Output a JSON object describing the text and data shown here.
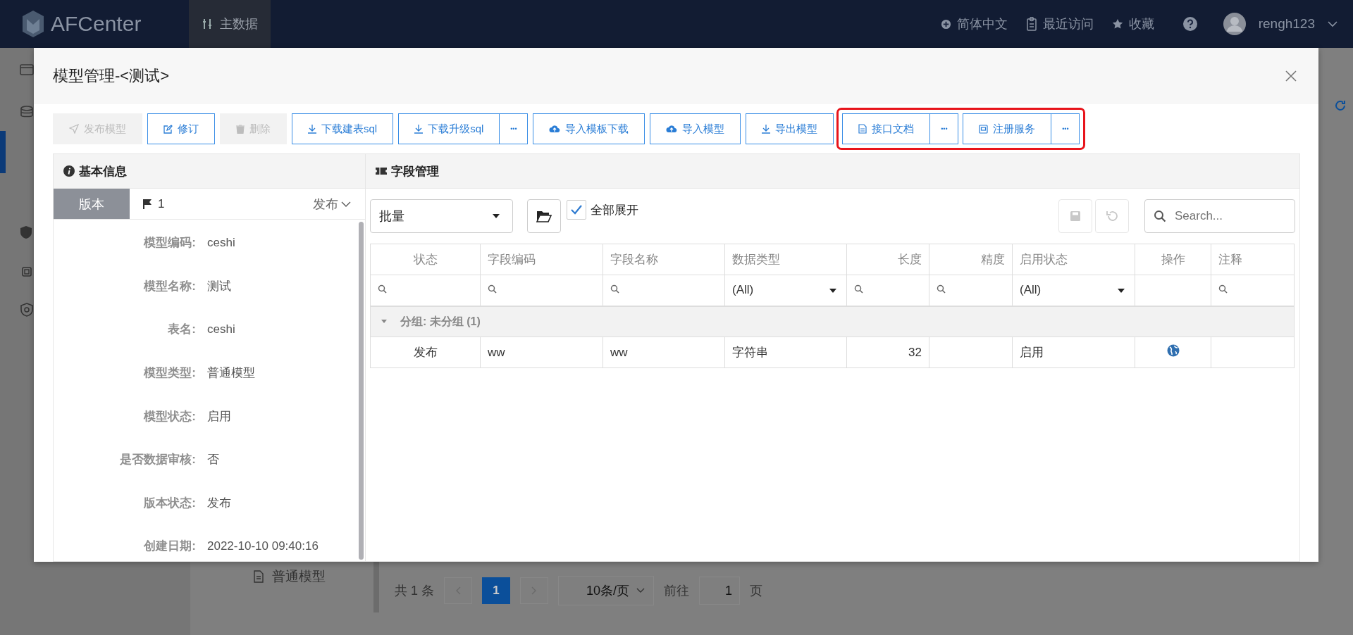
{
  "header": {
    "brand": "AFCenter",
    "nav": [
      {
        "label": "主数据",
        "selected": true
      }
    ],
    "links": [
      {
        "kind": "language",
        "label": "简体中文"
      },
      {
        "kind": "recent",
        "label": "最近访问"
      },
      {
        "kind": "favorites",
        "label": "收藏"
      }
    ],
    "user": "rengh123"
  },
  "background": {
    "tree_item": "普通模型",
    "pagination": {
      "total": "共 1 条",
      "pages": [
        {
          "label": "1",
          "selected": true
        }
      ],
      "page_size": "10条/页",
      "goto_label": "前往",
      "goto_value": "1",
      "goto_suffix": "页"
    }
  },
  "modal": {
    "title": "模型管理-<测试>",
    "toolbar": [
      {
        "highlighted": false,
        "buttons": [
          {
            "label": "发布模型",
            "kind": "send",
            "disabled": true
          },
          {
            "label": "修订",
            "kind": "edit",
            "disabled": false
          },
          {
            "label": "删除",
            "kind": "trash",
            "disabled": true
          },
          {
            "label": "下载建表sql",
            "kind": "download",
            "disabled": false
          },
          {
            "label": "下载升级sql",
            "kind": "download",
            "disabled": false,
            "more": "•••"
          },
          {
            "label": "导入模板下载",
            "kind": "cloud",
            "disabled": false
          },
          {
            "label": "导入模型",
            "kind": "cloud",
            "disabled": false
          },
          {
            "label": "导出模型",
            "kind": "download",
            "disabled": false
          }
        ]
      },
      {
        "highlighted": true,
        "buttons": [
          {
            "label": "接口文档",
            "kind": "doc",
            "disabled": false,
            "more": "•••"
          },
          {
            "label": "注册服务",
            "kind": "service",
            "disabled": false,
            "more": "•••"
          }
        ]
      }
    ],
    "info": {
      "title": "基本信息",
      "version_tab": "版本",
      "version": "1",
      "version_status": "发布",
      "fields": [
        {
          "label": "模型编码:",
          "value": "ceshi"
        },
        {
          "label": "模型名称:",
          "value": "测试"
        },
        {
          "label": "表名:",
          "value": "ceshi"
        },
        {
          "label": "模型类型:",
          "value": "普通模型"
        },
        {
          "label": "模型状态:",
          "value": "启用"
        },
        {
          "label": "是否数据审核:",
          "value": "否"
        },
        {
          "label": "版本状态:",
          "value": "发布"
        },
        {
          "label": "创建日期:",
          "value": "2022-10-10 09:40:16"
        }
      ]
    },
    "fields_panel": {
      "title": "字段管理",
      "batch_select": "批量",
      "expand_all": {
        "label": "全部展开",
        "checked": true
      },
      "save_disabled": true,
      "undo_disabled": true,
      "search": {
        "placeholder": "Search..."
      },
      "columns": [
        {
          "label": "状态",
          "filter": {
            "kind": "search"
          }
        },
        {
          "label": "字段编码",
          "filter": {
            "kind": "search"
          }
        },
        {
          "label": "字段名称",
          "filter": {
            "kind": "search"
          }
        },
        {
          "label": "数据类型",
          "filter": {
            "kind": "select",
            "value": "(All)"
          }
        },
        {
          "label": "长度",
          "filter": {
            "kind": "search"
          }
        },
        {
          "label": "精度",
          "filter": {
            "kind": "search"
          }
        },
        {
          "label": "启用状态",
          "filter": {
            "kind": "select",
            "value": "(All)"
          }
        },
        {
          "label": "操作",
          "filter": {
            "kind": "none"
          }
        },
        {
          "label": "注释",
          "filter": {
            "kind": "search"
          }
        }
      ],
      "groups": [
        {
          "label": "分组: 未分组 (1)",
          "expanded": true,
          "rows": [
            {
              "cells": [
                {
                  "kind": "text",
                  "text": "发布"
                },
                {
                  "kind": "text",
                  "text": "ww"
                },
                {
                  "kind": "text",
                  "text": "ww"
                },
                {
                  "kind": "text",
                  "text": "字符串"
                },
                {
                  "kind": "text",
                  "text": "32"
                },
                {
                  "kind": "empty"
                },
                {
                  "kind": "text",
                  "text": "启用"
                },
                {
                  "kind": "globe"
                },
                {
                  "kind": "empty"
                }
              ]
            }
          ]
        }
      ]
    }
  }
}
